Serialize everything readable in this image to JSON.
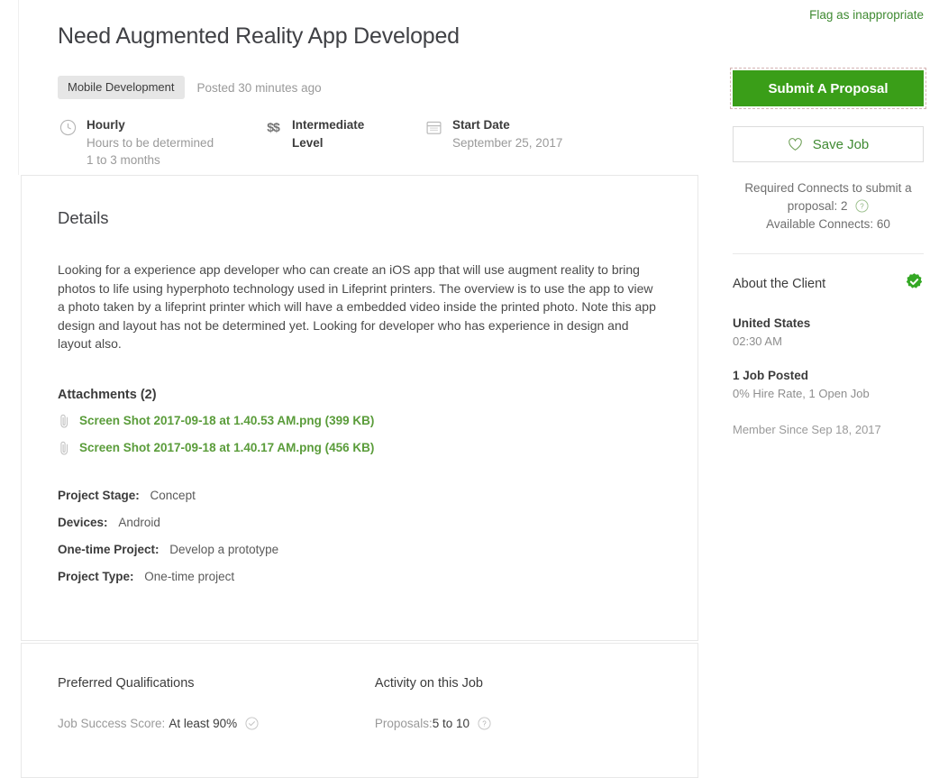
{
  "header": {
    "title": "Need Augmented Reality App Developed",
    "flag_label": "Flag as inappropriate"
  },
  "meta": {
    "category": "Mobile Development",
    "posted": "Posted 30 minutes ago",
    "facts": [
      {
        "icon": "clock-icon",
        "title": "Hourly",
        "sub1": "Hours to be determined",
        "sub2": "1 to 3 months"
      },
      {
        "icon": "dollars-icon",
        "glyph": "$$",
        "title": "Intermediate",
        "sub1": "Level",
        "sub2": ""
      },
      {
        "icon": "calendar-icon",
        "title": "Start Date",
        "sub1": "September 25, 2017",
        "sub2": ""
      }
    ]
  },
  "details": {
    "heading": "Details",
    "body": "Looking for a experience app developer who can create an iOS app that will use augment reality to bring photos to life using hyperphoto technology used in Lifeprint printers. The overview is to use the app to view a photo taken by a lifeprint printer which will have a embedded video inside the printed photo. Note this app design and layout has not be determined yet. Looking for developer who has experience in design and layout also.",
    "attachments_heading": "Attachments (2)",
    "attachments": [
      {
        "name": "Screen Shot 2017-09-18 at 1.40.53 AM.png (399 KB)"
      },
      {
        "name": "Screen Shot 2017-09-18 at 1.40.17 AM.png (456 KB)"
      }
    ],
    "specs": [
      {
        "label": "Project Stage:",
        "value": "Concept"
      },
      {
        "label": "Devices:",
        "value": "Android"
      },
      {
        "label": "One-time Project:",
        "value": "Develop a prototype"
      },
      {
        "label": "Project Type:",
        "value": "One-time project"
      }
    ]
  },
  "bottom": {
    "qualifications_heading": "Preferred Qualifications",
    "qualification_label": "Job Success Score:",
    "qualification_value": "At least 90%",
    "activity_heading": "Activity on this Job",
    "proposals_label": "Proposals:",
    "proposals_value": "5 to 10"
  },
  "sidebar": {
    "submit_label": "Submit A Proposal",
    "save_label": "Save Job",
    "connects_line1": "Required Connects to submit a",
    "connects_line2": "proposal: 2",
    "connects_line3": "Available Connects: 60",
    "client_heading": "About the Client",
    "country": "United States",
    "local_time": "02:30 AM",
    "jobs_posted": "1 Job Posted",
    "hire_rate": "0% Hire Rate, 1 Open Job",
    "member_since": "Member Since Sep 18, 2017"
  },
  "colors": {
    "brand_green": "#3a9e18",
    "link_green": "#3f8a32",
    "attachment_green": "#5a9c3a",
    "badge_bg": "#e6e6e6",
    "card_border": "#e8e8e8"
  }
}
